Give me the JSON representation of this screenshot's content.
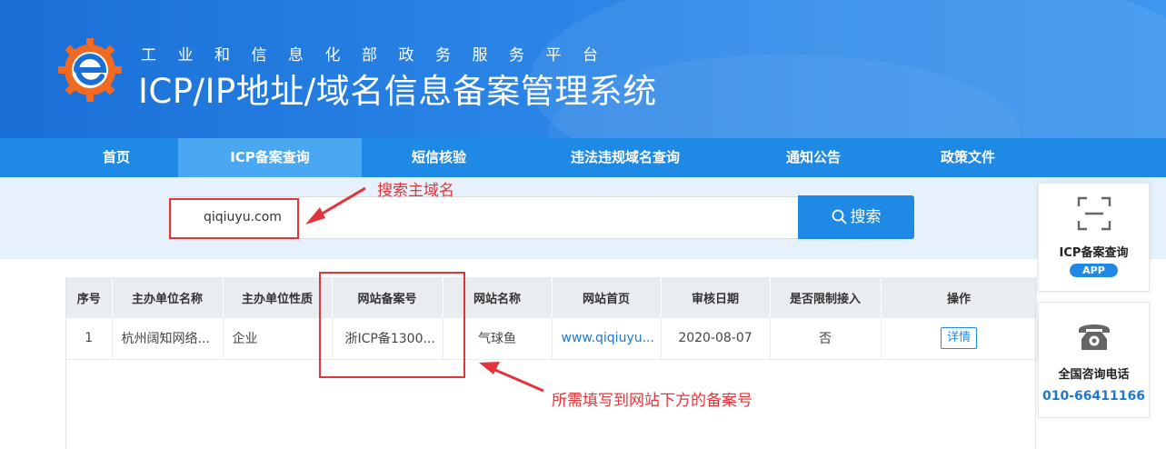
{
  "header": {
    "subtitle": "工业和信息化部政务服务平台",
    "title": "ICP/IP地址/域名信息备案管理系统"
  },
  "nav": {
    "items": [
      {
        "label": "首页",
        "active": false
      },
      {
        "label": "ICP备案查询",
        "active": true
      },
      {
        "label": "短信核验",
        "active": false
      },
      {
        "label": "违法违规域名查询",
        "active": false
      },
      {
        "label": "通知公告",
        "active": false
      },
      {
        "label": "政策文件",
        "active": false
      }
    ]
  },
  "search": {
    "value": "qiqiuyu.com",
    "button_label": "搜索"
  },
  "annotations": {
    "search_hint": "搜索主域名",
    "record_hint": "所需填写到网站下方的备案号"
  },
  "table": {
    "headers": [
      "序号",
      "主办单位名称",
      "主办单位性质",
      "网站备案号",
      "网站名称",
      "网站首页",
      "审核日期",
      "是否限制接入",
      "操作"
    ],
    "rows": [
      {
        "index": "1",
        "org_name": "杭州阔知网络...",
        "org_type": "企业",
        "record_no": "浙ICP备1300...",
        "site_name": "气球鱼",
        "homepage": "www.qiqiuyu...",
        "review_date": "2020-08-07",
        "restricted": "否",
        "action": "详情"
      }
    ]
  },
  "side": {
    "icp_query_label": "ICP备案查询",
    "app_badge": "APP",
    "hotline_label": "全国咨询电话",
    "hotline_number": "010-66411166"
  },
  "colors": {
    "primary": "#1f8ae6",
    "annotation": "#e0353b",
    "link": "#1f77d0"
  }
}
